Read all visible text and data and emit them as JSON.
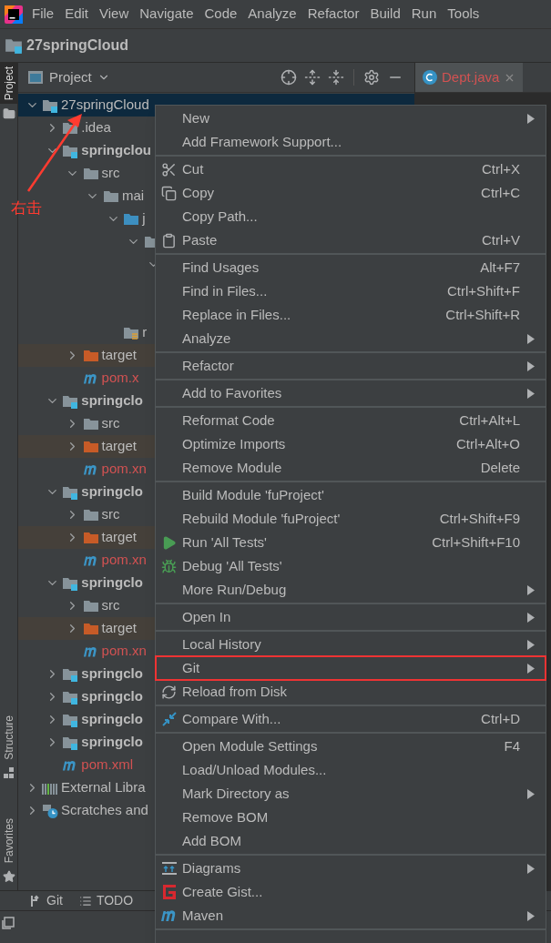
{
  "menu_bar": [
    "File",
    "Edit",
    "View",
    "Navigate",
    "Code",
    "Analyze",
    "Refactor",
    "Build",
    "Run",
    "Tools"
  ],
  "nav_bar": {
    "project": "27springCloud"
  },
  "left_strip": [
    {
      "label": "Project",
      "selected": true
    },
    {
      "label": "Structure",
      "selected": false
    },
    {
      "label": "Favorites",
      "selected": false
    }
  ],
  "project_panel": {
    "title": "Project",
    "tree": [
      {
        "label": "27springCloud",
        "kind": "project",
        "expanded": true,
        "selected": true,
        "children": [
          {
            "label": ".idea",
            "kind": "folder",
            "expanded": false,
            "selected": false
          },
          {
            "label": "springclou",
            "kind": "module",
            "expanded": true,
            "selected": false,
            "children": [
              {
                "label": "src",
                "kind": "folder",
                "expanded": true,
                "selected": false,
                "children": [
                  {
                    "label": "mai",
                    "kind": "folder",
                    "expanded": true,
                    "selected": false,
                    "children": [
                      {
                        "label": "j",
                        "kind": "source",
                        "expanded": true,
                        "selected": false,
                        "children": [
                          {
                            "kind": "package",
                            "expanded": true,
                            "selected": false,
                            "children": [
                              {
                                "expanded": true,
                                "selected": false,
                                "children": [
                                  {
                                    "selected": false
                                  },
                                  {
                                    "selected": false
                                  }
                                ]
                              }
                            ]
                          }
                        ]
                      },
                      {
                        "label": "r",
                        "kind": "resources",
                        "selected": false
                      }
                    ]
                  }
                ]
              },
              {
                "label": "target",
                "kind": "excluded",
                "expanded": false,
                "selected": false
              },
              {
                "label": "pom.x",
                "kind": "maven",
                "selected": false
              }
            ]
          },
          {
            "label": "springclo",
            "kind": "module",
            "expanded": true,
            "selected": false,
            "children": [
              {
                "label": "src",
                "kind": "folder",
                "expanded": false,
                "selected": false
              },
              {
                "label": "target",
                "kind": "excluded",
                "expanded": false,
                "selected": false
              },
              {
                "label": "pom.xn",
                "kind": "maven",
                "selected": false
              }
            ]
          },
          {
            "label": "springclo",
            "kind": "module",
            "expanded": true,
            "selected": false,
            "children": [
              {
                "label": "src",
                "kind": "folder",
                "expanded": false,
                "selected": false
              },
              {
                "label": "target",
                "kind": "excluded",
                "expanded": false,
                "selected": false
              },
              {
                "label": "pom.xn",
                "kind": "maven",
                "selected": false
              }
            ]
          },
          {
            "label": "springclo",
            "kind": "module",
            "expanded": true,
            "selected": false,
            "children": [
              {
                "label": "src",
                "kind": "folder",
                "expanded": false,
                "selected": false
              },
              {
                "label": "target",
                "kind": "excluded",
                "expanded": false,
                "selected": false
              },
              {
                "label": "pom.xn",
                "kind": "maven",
                "selected": false
              }
            ]
          },
          {
            "label": "springclo",
            "kind": "module",
            "expanded": false,
            "selected": false
          },
          {
            "label": "springclo",
            "kind": "module",
            "expanded": false,
            "selected": false
          },
          {
            "label": "springclo",
            "kind": "module",
            "expanded": false,
            "selected": false
          },
          {
            "label": "springclo",
            "kind": "module",
            "expanded": false,
            "selected": false
          },
          {
            "label": "pom.xml",
            "kind": "maven",
            "selected": false
          }
        ]
      },
      {
        "label": "External Libra",
        "kind": "libraries",
        "expanded": false,
        "selected": false
      },
      {
        "label": "Scratches and",
        "kind": "scratches",
        "expanded": false,
        "selected": false
      }
    ]
  },
  "editor_tabs": [
    {
      "label": "Dept.java",
      "selected": true
    }
  ],
  "context_menu": [
    [
      {
        "label": "New",
        "submenu": true,
        "marked": false
      },
      {
        "label": "Add Framework Support...",
        "submenu": false,
        "marked": false
      }
    ],
    [
      {
        "label": "Cut",
        "shortcut": "Ctrl+X",
        "submenu": false,
        "marked": false
      },
      {
        "label": "Copy",
        "shortcut": "Ctrl+C",
        "submenu": false,
        "marked": false
      },
      {
        "label": "Copy Path...",
        "submenu": false,
        "marked": false
      },
      {
        "label": "Paste",
        "shortcut": "Ctrl+V",
        "submenu": false,
        "marked": false
      }
    ],
    [
      {
        "label": "Find Usages",
        "shortcut": "Alt+F7",
        "submenu": false,
        "marked": false
      },
      {
        "label": "Find in Files...",
        "shortcut": "Ctrl+Shift+F",
        "submenu": false,
        "marked": false
      },
      {
        "label": "Replace in Files...",
        "shortcut": "Ctrl+Shift+R",
        "submenu": false,
        "marked": false
      },
      {
        "label": "Analyze",
        "submenu": true,
        "marked": false
      }
    ],
    [
      {
        "label": "Refactor",
        "submenu": true,
        "marked": false
      }
    ],
    [
      {
        "label": "Add to Favorites",
        "submenu": true,
        "marked": false
      }
    ],
    [
      {
        "label": "Reformat Code",
        "shortcut": "Ctrl+Alt+L",
        "submenu": false,
        "marked": false
      },
      {
        "label": "Optimize Imports",
        "shortcut": "Ctrl+Alt+O",
        "submenu": false,
        "marked": false
      },
      {
        "label": "Remove Module",
        "shortcut": "Delete",
        "submenu": false,
        "marked": false
      }
    ],
    [
      {
        "label": "Build Module 'fuProject'",
        "submenu": false,
        "marked": false
      },
      {
        "label": "Rebuild Module 'fuProject'",
        "shortcut": "Ctrl+Shift+F9",
        "submenu": false,
        "marked": false
      },
      {
        "label": "Run 'All Tests'",
        "shortcut": "Ctrl+Shift+F10",
        "submenu": false,
        "marked": false
      },
      {
        "label": "Debug 'All Tests'",
        "submenu": false,
        "marked": false
      },
      {
        "label": "More Run/Debug",
        "submenu": true,
        "marked": false
      }
    ],
    [
      {
        "label": "Open In",
        "submenu": true,
        "marked": false
      }
    ],
    [
      {
        "label": "Local History",
        "submenu": true,
        "marked": false
      },
      {
        "label": "Git",
        "submenu": true,
        "marked": true
      },
      {
        "label": "Reload from Disk",
        "submenu": false,
        "marked": false
      }
    ],
    [
      {
        "label": "Compare With...",
        "shortcut": "Ctrl+D",
        "submenu": false,
        "marked": false
      }
    ],
    [
      {
        "label": "Open Module Settings",
        "shortcut": "F4",
        "submenu": false,
        "marked": false
      },
      {
        "label": "Load/Unload Modules...",
        "submenu": false,
        "marked": false
      },
      {
        "label": "Mark Directory as",
        "submenu": true,
        "marked": false
      },
      {
        "label": "Remove BOM",
        "submenu": false,
        "marked": false
      },
      {
        "label": "Add BOM",
        "submenu": false,
        "marked": false
      }
    ],
    [
      {
        "label": "Diagrams",
        "submenu": true,
        "marked": false
      },
      {
        "label": "Create Gist...",
        "submenu": false,
        "marked": false
      },
      {
        "label": "Maven",
        "submenu": true,
        "marked": false
      }
    ]
  ],
  "tool_bar": [
    "Git",
    "TODO"
  ],
  "annotation": {
    "text": "右击"
  }
}
